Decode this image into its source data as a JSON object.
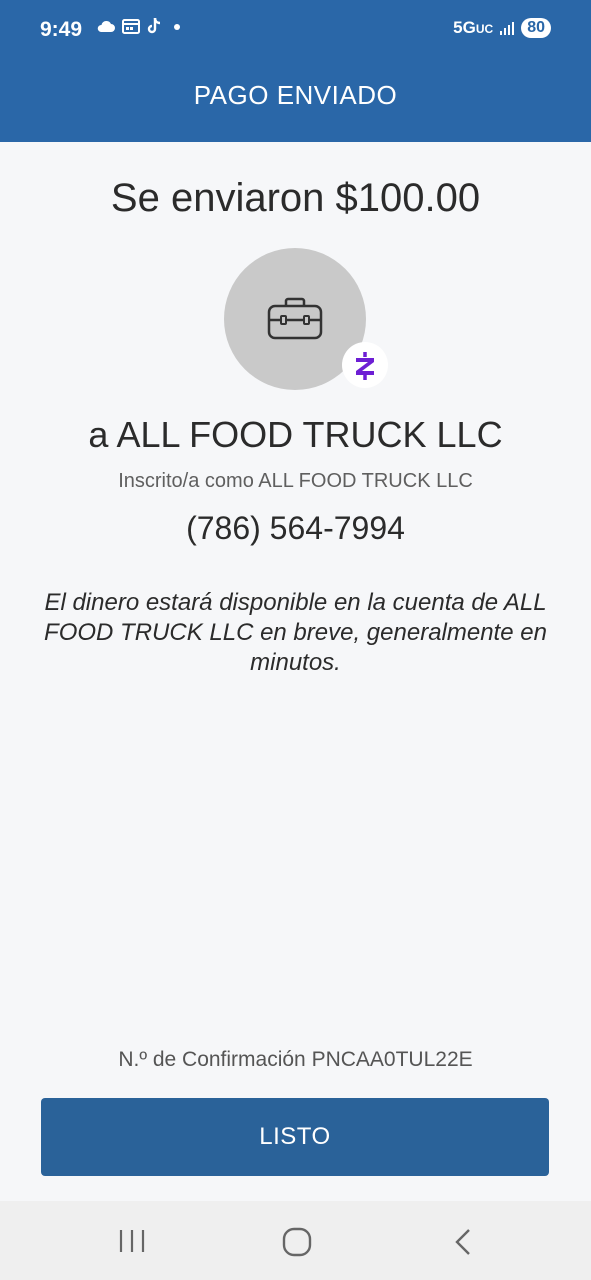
{
  "status_bar": {
    "time": "9:49",
    "network": "5G",
    "network_suffix": "UC",
    "battery": "80",
    "icons": [
      "cloud-icon",
      "calendar-icon",
      "tiktok-icon",
      "dot-icon",
      "signal-icon"
    ]
  },
  "header": {
    "title": "PAGO ENVIADO"
  },
  "payment": {
    "sent_text": "Se enviaron $100.00",
    "recipient_text": "a ALL FOOD TRUCK LLC",
    "enrolled_text": "Inscrito/a como ALL FOOD TRUCK LLC",
    "phone": "(786) 564-7994",
    "notice": "El dinero estará disponible en la cuenta de ALL FOOD TRUCK LLC en breve, generalmente en minutos.",
    "avatar_icon": "briefcase-icon",
    "badge_icon": "zelle-logo"
  },
  "footer": {
    "confirmation": "N.º de Confirmación PNCAA0TUL22E",
    "done_label": "LISTO"
  },
  "nav": {
    "icons": [
      "recent-apps-icon",
      "home-icon",
      "back-icon"
    ]
  },
  "colors": {
    "header_bg": "#2a67a8",
    "button_bg": "#2a6299",
    "zelle_purple": "#6d1ed4",
    "avatar_bg": "#c9c9c9",
    "page_bg": "#f6f7f9"
  }
}
